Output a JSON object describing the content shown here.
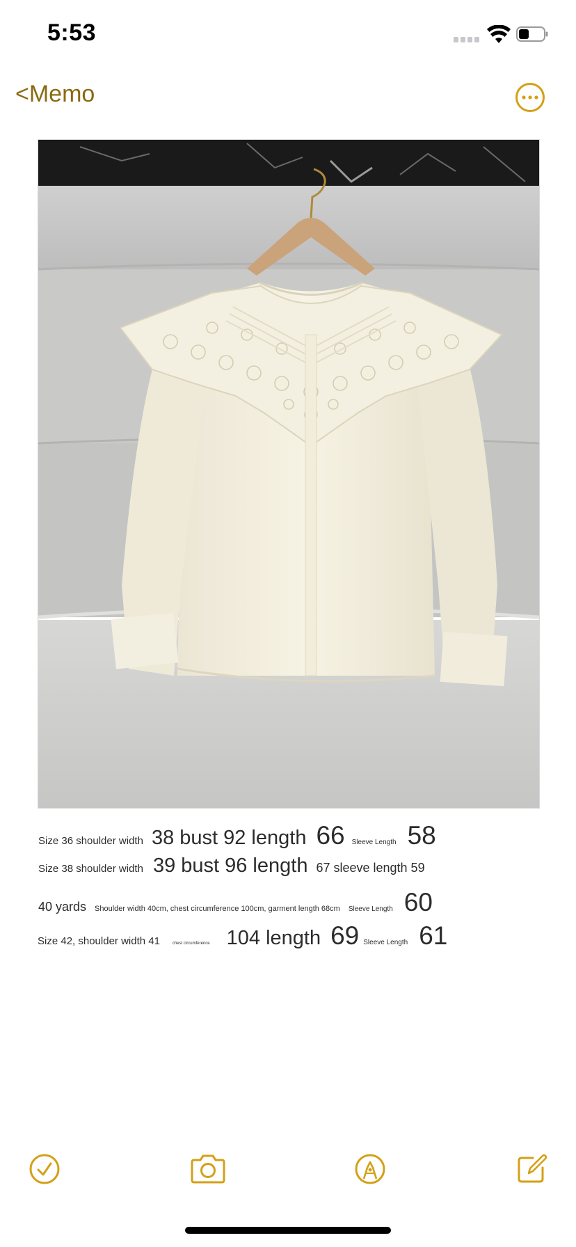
{
  "status_bar": {
    "time": "5:53",
    "icons": [
      "signal-icon",
      "wifi-icon",
      "battery-icon"
    ]
  },
  "nav": {
    "back_label": "<Memo",
    "more_icon": "ellipsis-circle-icon"
  },
  "colors": {
    "accent": "#D4A017",
    "back_text": "#8A6A12"
  },
  "size_chart": {
    "row1": {
      "size": "Size 36 shoulder width",
      "shoulder": "38 bust 92 length",
      "length": "66",
      "sleeve_label": "Sleeve Length",
      "sleeve": "58"
    },
    "row2": {
      "size": "Size 38 shoulder width",
      "shoulder": "39 bust 96 length",
      "rest": "67 sleeve length 59"
    },
    "row3": {
      "size": "40 yards",
      "detail": "Shoulder width 40cm, chest circumference 100cm, garment length 68cm",
      "sleeve_label": "Sleeve Length",
      "sleeve": "60"
    },
    "row4": {
      "size": "Size 42, shoulder width 41",
      "chest_label": "chest circumference",
      "chest": "104 length",
      "length": "69",
      "sleeve_label": "Sleeve Length",
      "sleeve": "61"
    }
  },
  "toolbar": {
    "checklist_icon": "checkmark-circle-icon",
    "camera_icon": "camera-icon",
    "markup_icon": "pen-tip-circle-icon",
    "compose_icon": "compose-icon"
  }
}
